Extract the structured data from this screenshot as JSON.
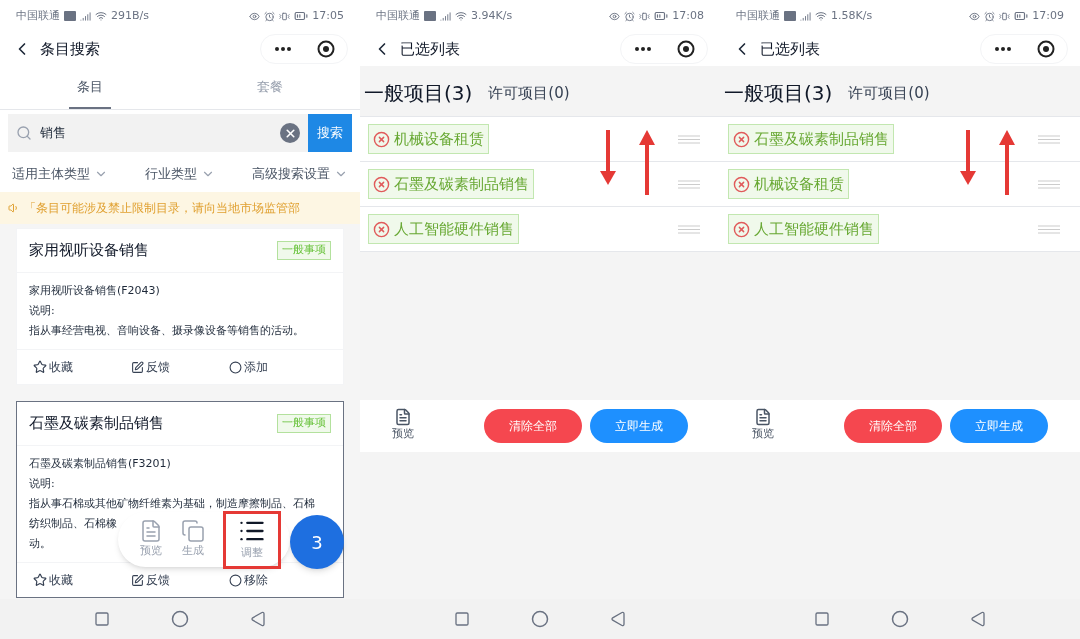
{
  "panels": [
    {
      "kind": "search",
      "status_bar": {
        "carrier": "中国联通",
        "speed": "291B/s",
        "time": "17:05"
      },
      "title": "条目搜索",
      "tabs": [
        {
          "label": "条目",
          "selected": true
        },
        {
          "label": "套餐",
          "selected": false
        }
      ],
      "search": {
        "value": "销售",
        "button": "搜索"
      },
      "filters": [
        "适用主体类型",
        "行业类型",
        "高级搜索设置"
      ],
      "notice": "「条目可能涉及禁止限制目录，请向当地市场监管部",
      "cards": [
        {
          "title": "家用视听设备销售",
          "badge": "一般事项",
          "added": false,
          "lines": [
            "家用视听设备销售(F2043)",
            "说明:",
            "指从事经营电视、音响设备、摄录像设备等销售的活动。"
          ],
          "actions": [
            {
              "kind": "star",
              "label": "收藏"
            },
            {
              "kind": "edit",
              "label": "反馈"
            },
            {
              "kind": "circle",
              "label": "添加"
            }
          ]
        },
        {
          "title": "石墨及碳素制品销售",
          "badge": "一般事项",
          "added": true,
          "lines": [
            "石墨及碳素制品销售(F3201)",
            "说明:",
            "指从事石棉或其他矿物纤维素为基础，制造摩擦制品、石棉",
            "纺织制品、石棉橡",
            "动。"
          ],
          "actions": [
            {
              "kind": "star",
              "label": "收藏"
            },
            {
              "kind": "edit",
              "label": "反馈"
            },
            {
              "kind": "circle",
              "label": "移除"
            }
          ]
        }
      ],
      "toolbar": {
        "items": [
          {
            "kind": "preview",
            "label": "预览",
            "highlighted": false
          },
          {
            "kind": "copy",
            "label": "生成",
            "highlighted": false
          },
          {
            "kind": "list",
            "label": "调整",
            "highlighted": true
          }
        ],
        "count": "3"
      }
    },
    {
      "kind": "list",
      "status_bar": {
        "carrier": "中国联通",
        "speed": "3.94K/s",
        "time": "17:08"
      },
      "title": "已选列表",
      "tabs": [
        {
          "label": "一般项目(3)",
          "selected": true
        },
        {
          "label": "许可项目(0)",
          "selected": false
        }
      ],
      "items": [
        "机械设备租赁",
        "石墨及碳素制品销售",
        "人工智能硬件销售"
      ],
      "preview": "预览",
      "buttons": [
        {
          "kind": "danger",
          "label": "清除全部"
        },
        {
          "kind": "primary",
          "label": "立即生成"
        }
      ]
    },
    {
      "kind": "list",
      "status_bar": {
        "carrier": "中国联通",
        "speed": "1.58K/s",
        "time": "17:09"
      },
      "title": "已选列表",
      "tabs": [
        {
          "label": "一般项目(3)",
          "selected": true
        },
        {
          "label": "许可项目(0)",
          "selected": false
        }
      ],
      "items": [
        "石墨及碳素制品销售",
        "机械设备租赁",
        "人工智能硬件销售"
      ],
      "preview": "预览",
      "buttons": [
        {
          "kind": "danger",
          "label": "清除全部"
        },
        {
          "kind": "primary",
          "label": "立即生成"
        }
      ]
    }
  ]
}
